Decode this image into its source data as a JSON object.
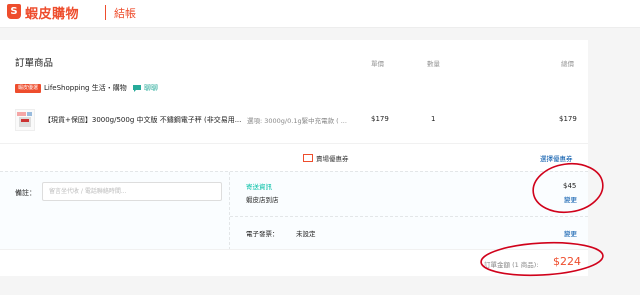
{
  "header": {
    "brand_icon": "S",
    "brand_name": "蝦皮購物",
    "page_title": "結帳"
  },
  "order": {
    "section_title": "訂單商品",
    "columns": {
      "unit_price": "單價",
      "quantity": "數量",
      "subtotal": "總價"
    },
    "shop": {
      "badge": "蝦皮優選",
      "name": "LifeShopping 生活・購物",
      "chat_label": "聊聊"
    },
    "item": {
      "name": "【現貨+保固】3000g/500g 中文版 不鏽鋼電子秤 (非交易用...",
      "variant": "選項: 3000g/0.1g緊中充電款 ( ...",
      "price": "$179",
      "quantity": "1",
      "total": "$179"
    },
    "coupon": {
      "label": "賣場優惠券",
      "select_label": "選擇優惠券"
    },
    "note": {
      "label": "備註：",
      "placeholder": "留言坐代收 / 電話聯絡時間..."
    },
    "shipping": {
      "label": "寄送資訊",
      "method": "蝦皮店到店",
      "fee": "$45",
      "change_label": "變更"
    },
    "invoice": {
      "label": "電子發票：",
      "value": "未設定",
      "change_label": "變更"
    },
    "total": {
      "label": "訂單金額 (1 商品):",
      "value": "$224"
    }
  },
  "colors": {
    "brand": "#ee4d2d",
    "link": "#0055aa",
    "teal": "#00bfa5",
    "annotation": "#d0021b"
  }
}
